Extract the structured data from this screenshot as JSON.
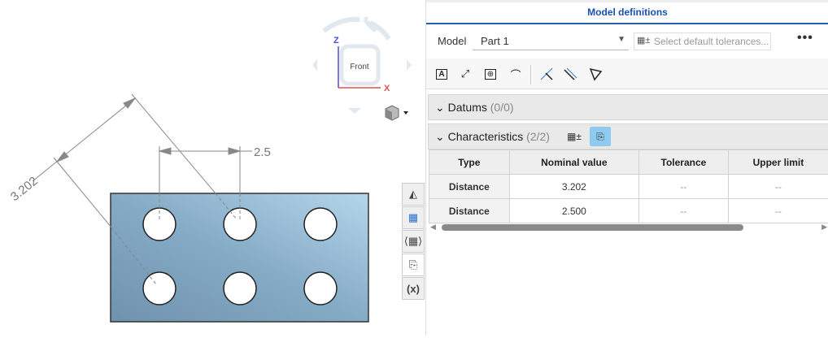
{
  "viewport": {
    "view_cube": {
      "face_label": "Front",
      "axis_z": "Z",
      "axis_x": "X"
    },
    "dimensions": [
      {
        "label": "3.202"
      },
      {
        "label": "2.5"
      }
    ],
    "sidebar_icons": [
      "render-mode-icon",
      "model-definitions-icon",
      "pmi-icon",
      "annotations-icon",
      "variables-icon"
    ]
  },
  "panel": {
    "title": "Model definitions",
    "model_label": "Model",
    "model_value": "Part 1",
    "tolerance_placeholder": "Select default tolerances...",
    "more": "•••",
    "toolbar_icons": [
      "datum-feature-icon",
      "dimension-icon",
      "feature-control-frame-icon",
      "profile-icon",
      "intersection-icon",
      "parallel-icon",
      "angle-icon"
    ],
    "datums": {
      "title": "Datums",
      "count": "(0/0)"
    },
    "characteristics": {
      "title": "Characteristics",
      "count": "(2/2)"
    },
    "table": {
      "headers": [
        "Type",
        "Nominal value",
        "Tolerance",
        "Upper limit"
      ],
      "rows": [
        [
          "Distance",
          "3.202",
          "--",
          "--"
        ],
        [
          "Distance",
          "2.500",
          "--",
          "--"
        ]
      ]
    }
  },
  "colors": {
    "accent": "#1a4fb4",
    "active_icon": "#8fcbef",
    "part_fill": "#7ea4bf"
  }
}
